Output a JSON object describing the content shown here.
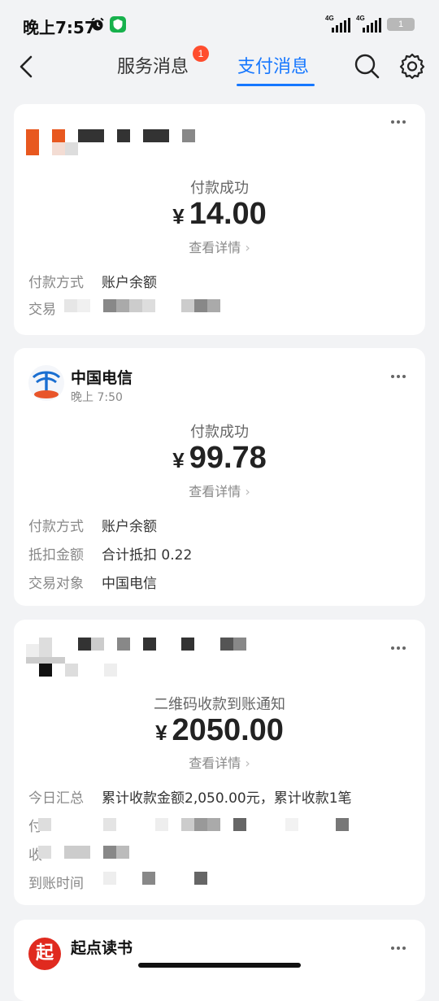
{
  "status_bar": {
    "time": "晚上7:57",
    "battery": "1",
    "network1": "4G",
    "network2": "4G"
  },
  "nav": {
    "tab_service": "服务消息",
    "tab_service_badge": "1",
    "tab_payment": "支付消息"
  },
  "cards": [
    {
      "status": "付款成功",
      "currency": "¥",
      "amount": "14.00",
      "detail_link": "查看详情",
      "rows": [
        {
          "label": "付款方式",
          "value": "账户余额"
        },
        {
          "label": "交易",
          "value": ""
        }
      ]
    },
    {
      "merchant": "中国电信",
      "time": "晚上 7:50",
      "status": "付款成功",
      "currency": "¥",
      "amount": "99.78",
      "detail_link": "查看详情",
      "rows": [
        {
          "label": "付款方式",
          "value": "账户余额"
        },
        {
          "label": "抵扣金额",
          "value": "合计抵扣 0.22"
        },
        {
          "label": "交易对象",
          "value": "中国电信"
        }
      ]
    },
    {
      "status": "二维码收款到账通知",
      "currency": "¥",
      "amount": "2050.00",
      "detail_link": "查看详情",
      "rows": [
        {
          "label": "今日汇总",
          "value": "累计收款金额2,050.00元，累计收款1笔"
        },
        {
          "label": "付",
          "value": ""
        },
        {
          "label": "收",
          "value": ""
        },
        {
          "label": "到账时间",
          "value": ""
        }
      ]
    },
    {
      "merchant": "起点读书",
      "logo_text": "起"
    }
  ]
}
